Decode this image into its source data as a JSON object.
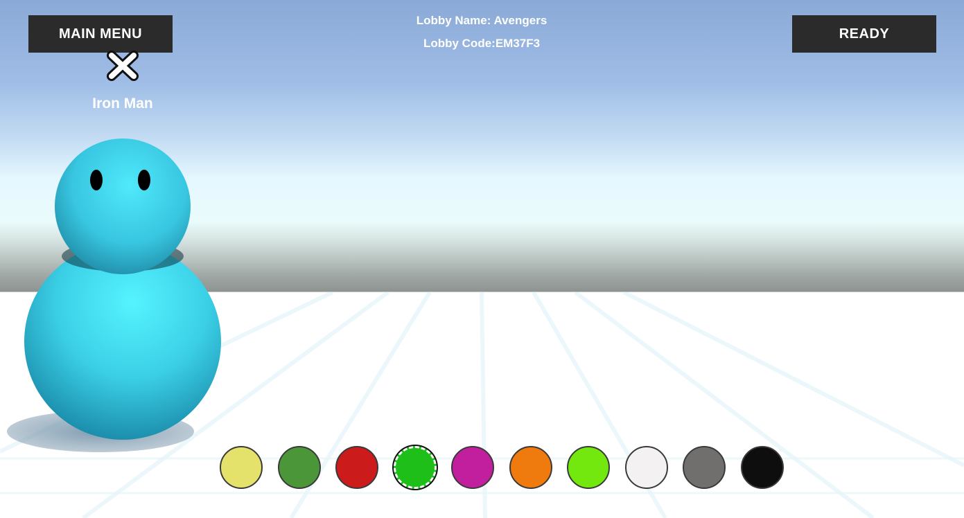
{
  "header": {
    "main_menu_label": "MAIN MENU",
    "ready_label": "READY",
    "lobby_name": "Lobby Name: Avengers",
    "lobby_code": "Lobby Code:EM37F3"
  },
  "player": {
    "name": "Iron Man",
    "kick_icon": "close-x-icon",
    "body_color": "#3fd8ef"
  },
  "colors": [
    {
      "name": "yellow",
      "hex": "#e4e26a",
      "selected": false
    },
    {
      "name": "green",
      "hex": "#4c963a",
      "selected": false
    },
    {
      "name": "red",
      "hex": "#cc1b1b",
      "selected": false
    },
    {
      "name": "bright-green",
      "hex": "#1fbf1a",
      "selected": true
    },
    {
      "name": "magenta",
      "hex": "#c21f9e",
      "selected": false
    },
    {
      "name": "orange",
      "hex": "#ef7a0e",
      "selected": false
    },
    {
      "name": "lime",
      "hex": "#72e80f",
      "selected": false
    },
    {
      "name": "white",
      "hex": "#f3f1f1",
      "selected": false
    },
    {
      "name": "gray",
      "hex": "#716e6e",
      "selected": false
    },
    {
      "name": "black",
      "hex": "#0e0e0e",
      "selected": false
    }
  ]
}
